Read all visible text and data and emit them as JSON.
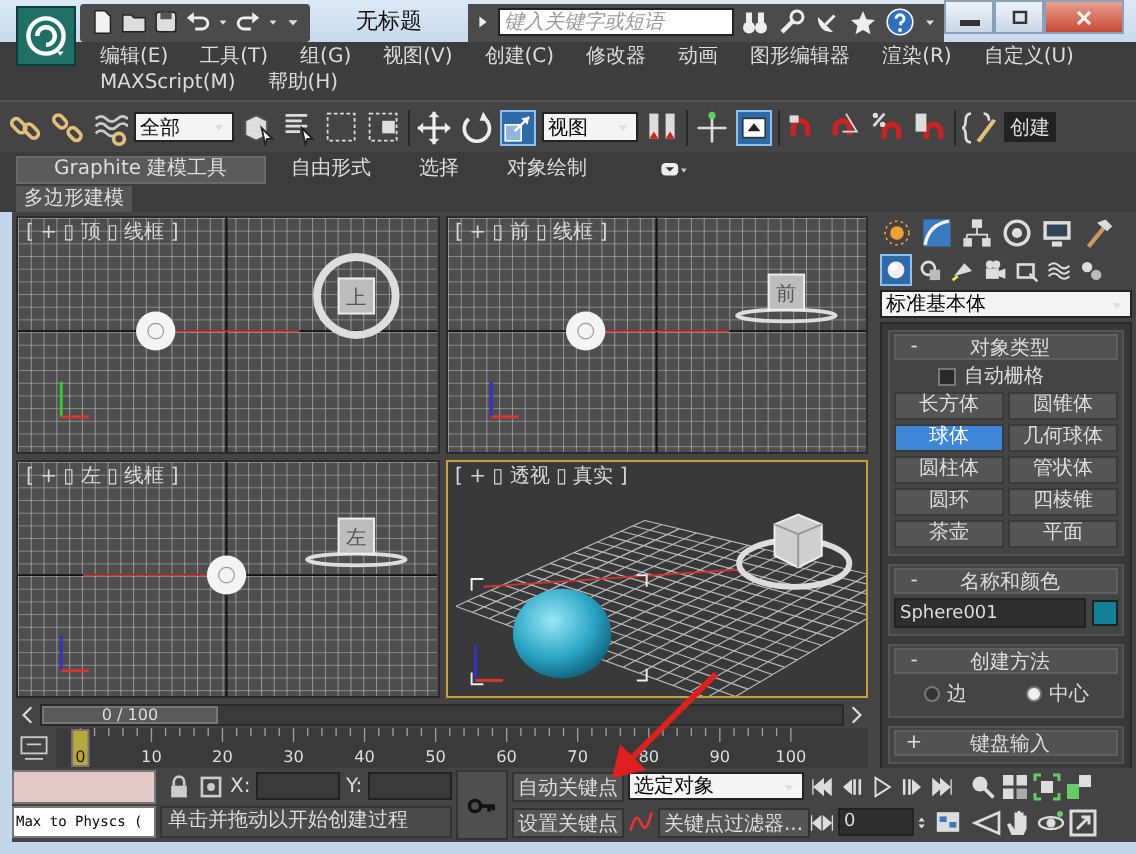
{
  "window": {
    "title": "无标题",
    "search_placeholder": "键入关键字或短语"
  },
  "menu": [
    "编辑(E)",
    "工具(T)",
    "组(G)",
    "视图(V)",
    "创建(C)",
    "修改器",
    "动画",
    "图形编辑器",
    "渲染(R)",
    "自定义(U)",
    "MAXScript(M)",
    "帮助(H)"
  ],
  "toolbar": {
    "selection_filter": "全部",
    "coordinate_system": "视图",
    "named_selection": "创建"
  },
  "ribbon": {
    "tabs": [
      {
        "label": "Graphite 建模工具",
        "selected": true
      },
      {
        "label": "自由形式",
        "selected": false
      },
      {
        "label": "选择",
        "selected": false
      },
      {
        "label": "对象绘制",
        "selected": false
      }
    ],
    "panel_tab": "多边形建模"
  },
  "viewports": [
    {
      "kind": "ortho",
      "label": "[ + ▯ 顶 ▯ 线框 ]",
      "cube_label": "上",
      "active": false
    },
    {
      "kind": "ortho",
      "label": "[ + ▯ 前 ▯ 线框 ]",
      "cube_label": "前",
      "active": false
    },
    {
      "kind": "ortho",
      "label": "[ + ▯ 左 ▯ 线框 ]",
      "cube_label": "左",
      "active": false
    },
    {
      "kind": "perspective",
      "label": "[ + ▯ 透视 ▯ 真实 ]",
      "active": true
    }
  ],
  "time_slider": {
    "reading": "0 / 100",
    "level": 0
  },
  "timeline": {
    "ticks": [
      "0",
      "10",
      "20",
      "30",
      "40",
      "50",
      "60",
      "70",
      "80",
      "90",
      "100"
    ]
  },
  "command_panel": {
    "category": "标准基本体",
    "object_type": {
      "toggle": "-",
      "title": "对象类型",
      "auto_grid": {
        "label": "自动栅格",
        "checked": false
      },
      "buttons": [
        {
          "label": "长方体",
          "selected": false
        },
        {
          "label": "圆锥体",
          "selected": false
        },
        {
          "label": "球体",
          "selected": true
        },
        {
          "label": "几何球体",
          "selected": false
        },
        {
          "label": "圆柱体",
          "selected": false
        },
        {
          "label": "管状体",
          "selected": false
        },
        {
          "label": "圆环",
          "selected": false
        },
        {
          "label": "四棱锥",
          "selected": false
        },
        {
          "label": "茶壶",
          "selected": false
        },
        {
          "label": "平面",
          "selected": false
        }
      ]
    },
    "name_and_color": {
      "toggle": "-",
      "title": "名称和颜色",
      "name": "Sphere001",
      "color": "#13809a"
    },
    "creation_method": {
      "toggle": "-",
      "title": "创建方法",
      "options": [
        {
          "label": "边",
          "selected": false
        },
        {
          "label": "中心",
          "selected": true
        }
      ]
    },
    "keyboard_entry": {
      "toggle": "+",
      "title": "键盘输入"
    }
  },
  "status": {
    "listener": "Max to Physcs (",
    "x_label": "X:",
    "y_label": "Y:",
    "prompt": "单击并拖动以开始创建过程"
  },
  "keys": {
    "auto_key": "自动关键点",
    "key_mode": "选定对象",
    "set_key": "设置关键点",
    "key_filters": "关键点过滤器...",
    "frame": "0"
  },
  "annotations": [
    {
      "kind": "arrow"
    }
  ]
}
